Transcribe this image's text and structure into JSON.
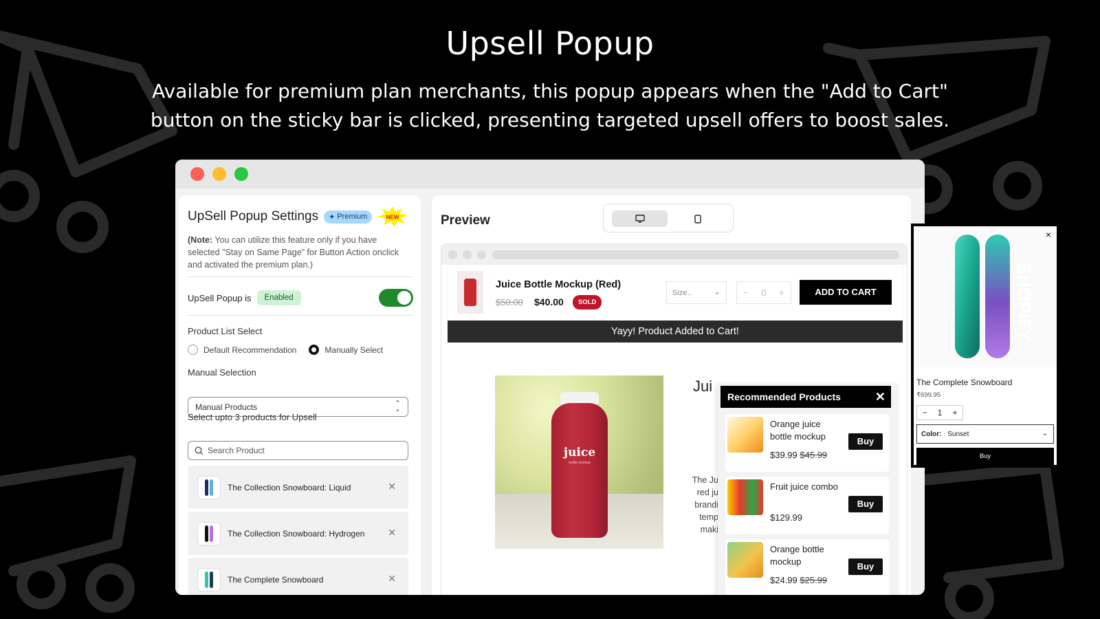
{
  "hero": {
    "title": "Upsell Popup",
    "subtitle": "Available for premium plan merchants, this popup appears when the \"Add to Cart\" button on the sticky bar is clicked, presenting targeted upsell offers to boost sales."
  },
  "settings": {
    "title": "UpSell Popup Settings",
    "premium_badge": "Premium",
    "new_badge": "NEW",
    "note_prefix": "(Note:",
    "note_text": " You can utilize this feature only if you have selected \"Stay on Same Page\" for Button Action onclick and activated the premium plan.)",
    "toggle_label": "UpSell Popup is",
    "toggle_status": "Enabled",
    "toggle_on": true,
    "product_list_label": "Product List Select",
    "radio_default": "Default Recommendation",
    "radio_manual": "Manually Select",
    "selected_radio": "manual",
    "manual_selection_label": "Manual Selection",
    "manual_selection_value": "Manual Products",
    "select_upto_label": "Select upto 3 products for Upsell",
    "search_placeholder": "Search Product",
    "selected_products": [
      {
        "name": "The Collection Snowboard: Liquid",
        "colors": [
          "#1b2b5e",
          "#5fb0d8"
        ]
      },
      {
        "name": "The Collection Snowboard: Hydrogen",
        "colors": [
          "#111111",
          "#b76fe0"
        ]
      },
      {
        "name": "The Complete Snowboard",
        "colors": [
          "#2fc7a9",
          "#27394f"
        ]
      }
    ]
  },
  "preview": {
    "title": "Preview",
    "sticky": {
      "product_name": "Juice Bottle Mockup (Red)",
      "old_price": "$50.00",
      "new_price": "$40.00",
      "sold_badge": "SOLD",
      "size_placeholder": "Size..",
      "qty_minus": "−",
      "qty_value": "0",
      "qty_plus": "+",
      "add_to_cart": "ADD TO CART"
    },
    "added_message": "Yayy! Product Added to Cart!",
    "bottle_label": "juice",
    "bottle_sub": "bottle mockup",
    "right_title": "Jui",
    "description_lines": [
      "The Ju",
      "red ju",
      "brandi",
      "temp",
      "maki"
    ],
    "recommended": {
      "title": "Recommended Products",
      "close": "✕",
      "buy_label": "Buy",
      "items": [
        {
          "name": "Orange juice bottle mockup",
          "price": "$39.99",
          "compare": "$45.99"
        },
        {
          "name": "Fruit juice combo",
          "price": "$129.99",
          "compare": ""
        },
        {
          "name": "Orange bottle mockup",
          "price": "$24.99",
          "compare": "$25.99"
        }
      ]
    }
  },
  "snowboard_popup": {
    "close": "×",
    "name": "The Complete Snowboard",
    "price": "₹699.95",
    "qty_minus": "−",
    "qty_value": "1",
    "qty_plus": "+",
    "color_label": "Color:",
    "color_value": "Sunset",
    "buy_label": "Buy",
    "board_text": "SHOPIFY"
  },
  "colors": {
    "accent_green": "#1f8a2c",
    "sold_red": "#c0152a",
    "premium_blue": "#a5d8ff"
  }
}
